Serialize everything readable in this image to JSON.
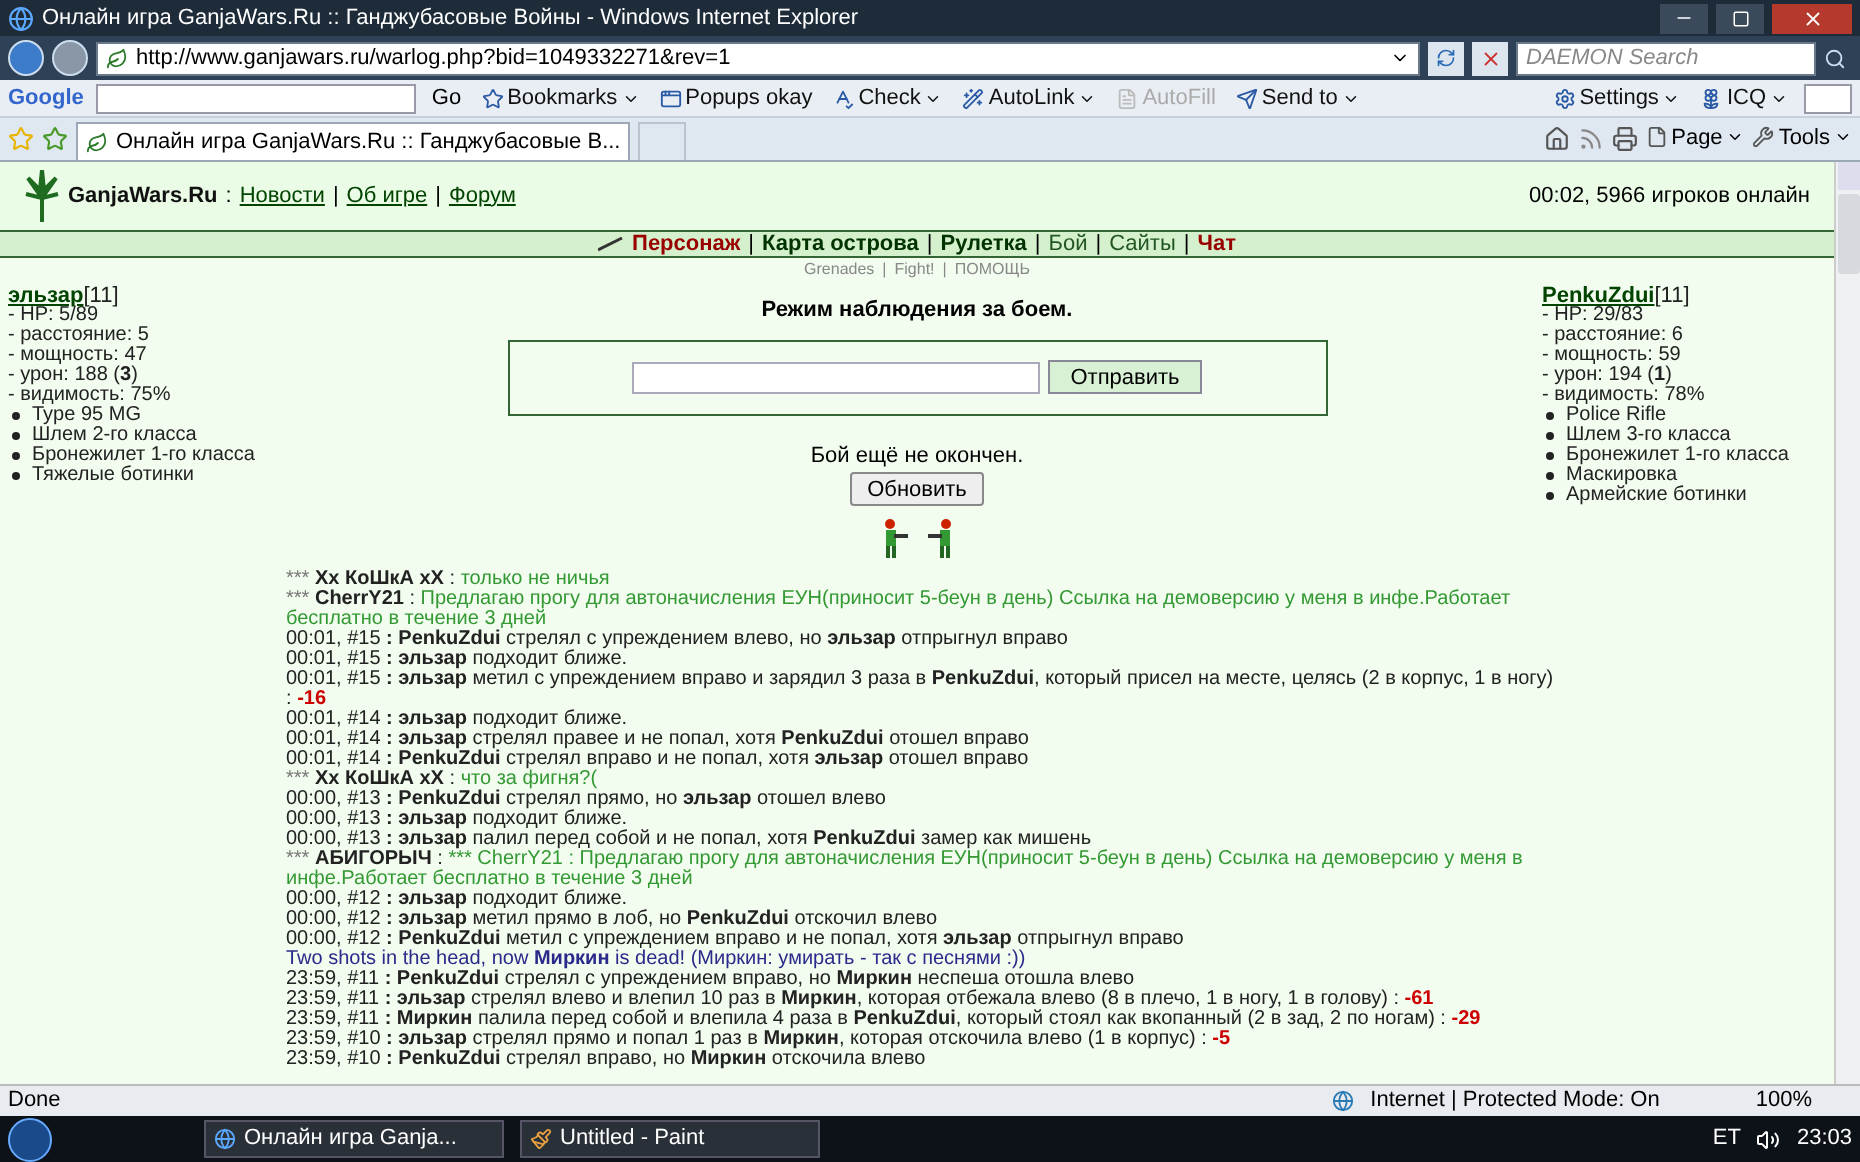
{
  "window": {
    "title": "Онлайн игра GanjaWars.Ru :: Ганджубасовые Войны - Windows Internet Explorer"
  },
  "address_bar": {
    "url": "http://www.ganjawars.ru/warlog.php?bid=1049332271&rev=1"
  },
  "search": {
    "placeholder": "DAEMON Search"
  },
  "toolbar": {
    "logo": "Google",
    "search_button": "Go",
    "items": [
      {
        "label": "Bookmarks",
        "dropdown": true,
        "disabled": false
      },
      {
        "label": "Popups okay",
        "dropdown": false,
        "disabled": false
      },
      {
        "label": "Check",
        "dropdown": true,
        "disabled": false
      },
      {
        "label": "AutoLink",
        "dropdown": true,
        "disabled": false
      },
      {
        "label": "AutoFill",
        "dropdown": false,
        "disabled": true
      },
      {
        "label": "Send to",
        "dropdown": true,
        "disabled": false
      },
      {
        "label": "Settings",
        "dropdown": true,
        "disabled": false
      },
      {
        "label": "ICQ",
        "dropdown": true,
        "disabled": false
      }
    ]
  },
  "tab": {
    "label": "Онлайн игра GanjaWars.Ru :: Ганджубасовые В..."
  },
  "commands": [
    "Page",
    "Tools"
  ],
  "site": {
    "name": "GanjaWars.Ru",
    "colon": ":",
    "links": [
      "Новости",
      "Об игре",
      "Форум"
    ],
    "separator": "|",
    "online": "00:02, 5966 игроков онлайн"
  },
  "nav": {
    "items": [
      {
        "label": "Персонаж",
        "kind": "highlight"
      },
      {
        "label": "Карта острова",
        "kind": "bold"
      },
      {
        "label": "Рулетка",
        "kind": "bold"
      },
      {
        "label": "Бой",
        "kind": "normal"
      },
      {
        "label": "Сайты",
        "kind": "normal"
      },
      {
        "label": "Чат",
        "kind": "highlight"
      }
    ],
    "sub_links": [
      "Grenades",
      "Fight!",
      "ПОМОЩЬ"
    ]
  },
  "fighters": [
    {
      "name": "эльзар",
      "level": "[11]",
      "stats": [
        "- HP: 5/89",
        "- расстояние: 5",
        "- мощность: 47",
        "- урон: 188 (**3**)",
        "- видимость: 75%"
      ],
      "items": [
        "Type 95 MG",
        "Шлем 2-го класса",
        "Бронежилет 1-го класса",
        "Тяжелые ботинки"
      ]
    },
    {
      "name": "PenkuZdui",
      "level": "[11]",
      "stats": [
        "- HP: 29/83",
        "- расстояние: 6",
        "- мощность: 59",
        "- урон: 194 (**1**)",
        "- видимость: 78%"
      ],
      "items": [
        "Police Rifle",
        "Шлем 3-го класса",
        "Бронежилет 1-го класса",
        "Маскировка",
        "Армейские ботинки"
      ]
    }
  ],
  "observer": {
    "title": "Режим наблюдения за боем.",
    "send_button": "Отправить",
    "status": "Бой ещё не окончен.",
    "refresh_button": "Обновить"
  },
  "log": [
    {
      "kind": "chat",
      "prefix": "***",
      "author": "Xx КоШкА xX",
      "suffix": ":",
      "message": "только не ничья"
    },
    {
      "kind": "chat",
      "prefix": "***",
      "author": "CherrY21",
      "suffix": ":",
      "message": "Предлагаю прогу для автоначисления ЕУН(приносит 5-беун в день) Ссылка на демоверсию у меня в инфе.Работает бесплатно в течение 3 дней"
    },
    {
      "kind": "event",
      "text": "00:01, #15 **: PenkuZdui** стрелял с упреждением влево, но **эльзар** отпрыгнул вправо"
    },
    {
      "kind": "event",
      "text": "00:01, #15 **: эльзар** подходит ближе."
    },
    {
      "kind": "event",
      "text": "00:01, #15 **: эльзар** метил с упреждением вправо и зарядил 3 раза в **PenkuZdui**, который присел на месте, целясь (2 в корпус, 1 в ногу) :",
      "damage": "-16"
    },
    {
      "kind": "event",
      "text": "00:01, #14 **: эльзар** подходит ближе."
    },
    {
      "kind": "event",
      "text": "00:01, #14 **: эльзар** стрелял правее и не попал, хотя **PenkuZdui** отошел вправо"
    },
    {
      "kind": "event",
      "text": "00:01, #14 **: PenkuZdui** стрелял вправо и не попал, хотя **эльзар** отошел вправо"
    },
    {
      "kind": "chat",
      "prefix": "***",
      "author": "Xx КоШкА xX",
      "suffix": ":",
      "message": "что за фигня?("
    },
    {
      "kind": "event",
      "text": "00:00, #13 **: PenkuZdui** стрелял прямо, но **эльзар** отошел влево"
    },
    {
      "kind": "event",
      "text": "00:00, #13 **: эльзар** подходит ближе."
    },
    {
      "kind": "event",
      "text": "00:00, #13 **: эльзар** палил перед собой и не попал, хотя **PenkuZdui** замер как мишень"
    },
    {
      "kind": "chat",
      "prefix": "***",
      "author": "АБИГОРЫЧ",
      "suffix": ":",
      "message": "*** CherrY21 : Предлагаю прогу для автоначисления ЕУН(приносит 5-беун в день) Ссылка на демоверсию у меня в инфе.Работает бесплатно в течение 3 дней"
    },
    {
      "kind": "event",
      "text": "00:00, #12 **: эльзар** подходит ближе."
    },
    {
      "kind": "event",
      "text": "00:00, #12 **: эльзар** метил прямо в лоб, но **PenkuZdui** отскочил влево"
    },
    {
      "kind": "event",
      "text": "00:00, #12 **: PenkuZdui** метил с упреждением вправо и не попал, хотя **эльзар** отпрыгнул вправо"
    },
    {
      "kind": "death",
      "text": "Two shots in the head, now **Миркин** is dead! (Миркин: умирать - так с песнями :))"
    },
    {
      "kind": "event",
      "text": "23:59, #11 **: PenkuZdui** стрелял с упреждением вправо, но **Миркин** неспеша отошла влево"
    },
    {
      "kind": "event",
      "text": "23:59, #11 **: эльзар** стрелял влево и влепил 10 раз в **Миркин**, которая отбежала влево (8 в плечо, 1 в ногу, 1 в голову) :",
      "damage": "-61"
    },
    {
      "kind": "event",
      "text": "23:59, #11 **: Миркин** палила перед собой и влепила 4 раза в **PenkuZdui**, который стоял как вкопанный (2 в зад, 2 по ногам) :",
      "damage": "-29"
    },
    {
      "kind": "event",
      "text": "23:59, #10 **: эльзар** стрелял прямо и попал 1 раз в **Миркин**, которая отскочила влево (1 в корпус) :",
      "damage": "-5"
    },
    {
      "kind": "event",
      "text": "23:59, #10 **: PenkuZdui** стрелял вправо, но **Миркин** отскочила влево"
    }
  ],
  "status_bar": {
    "text": "Done",
    "zone": "Internet | Protected Mode: On",
    "zoom": "100%"
  },
  "taskbar": {
    "tasks": [
      "Онлайн игра Ganja...",
      "Untitled - Paint"
    ],
    "language": "ET",
    "clock": "23:03"
  }
}
